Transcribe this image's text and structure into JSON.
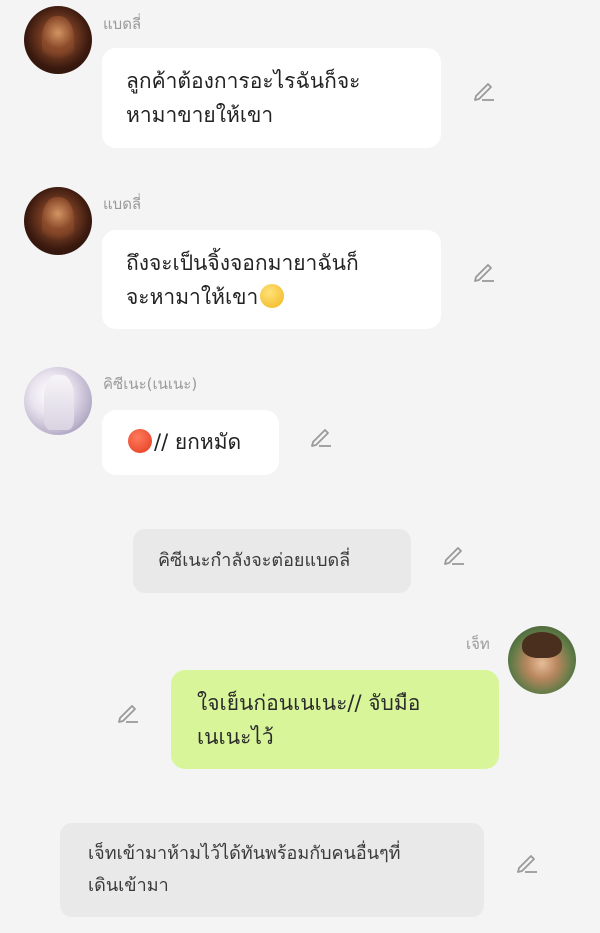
{
  "messages": [
    {
      "sender": "แบดลี่",
      "text": "ลูกค้าต้องการอะไรฉันก็จะหามาขายให้เขา"
    },
    {
      "sender": "แบดลี่",
      "text": "ถึงจะเป็นจิ้งจอกมายาฉันก็จะหามาให้เขา"
    },
    {
      "sender": "คิซีเนะ(เนเนะ)",
      "text": "// ยกหมัด"
    },
    {
      "system": "คิซีเนะกำลังจะต่อยแบดลี่"
    },
    {
      "sender": "เจ็ท",
      "text": "ใจเย็นก่อนเนเนะ// จับมือเนเนะไว้"
    },
    {
      "system": "เจ็ทเข้ามาห้ามไว้ได้ทันพร้อมกับคนอื่นๆที่เดินเข้ามา"
    }
  ],
  "lines": {
    "m1_l1": "ลูกค้าต้องการอะไรฉันก็จะ",
    "m1_l2": "หามาขายให้เขา",
    "m2_l1": "ถึงจะเป็นจิ้งจอกมายาฉันก็",
    "m2_l2": "จะหามาให้เขา",
    "m5_l1": "ใจเย็นก่อนเนเนะ// จับมือ",
    "m5_l2": "เนเนะไว้",
    "s2_l1": "เจ็ทเข้ามาห้ามไว้ได้ทันพร้อมกับคนอื่นๆที่",
    "s2_l2": "เดินเข้ามา"
  },
  "colors": {
    "background": "#f4f4f4",
    "bubble": "#ffffff",
    "bubble_self": "#d8f59a",
    "system_bubble": "#e9e9e9",
    "sender_name": "#9a9a9a",
    "icon": "#9a9a9a"
  },
  "icons": {
    "edit": "pencil-edit-icon",
    "emoji_smirk": "smirking-face-emoji",
    "emoji_angry": "angry-face-emoji"
  }
}
